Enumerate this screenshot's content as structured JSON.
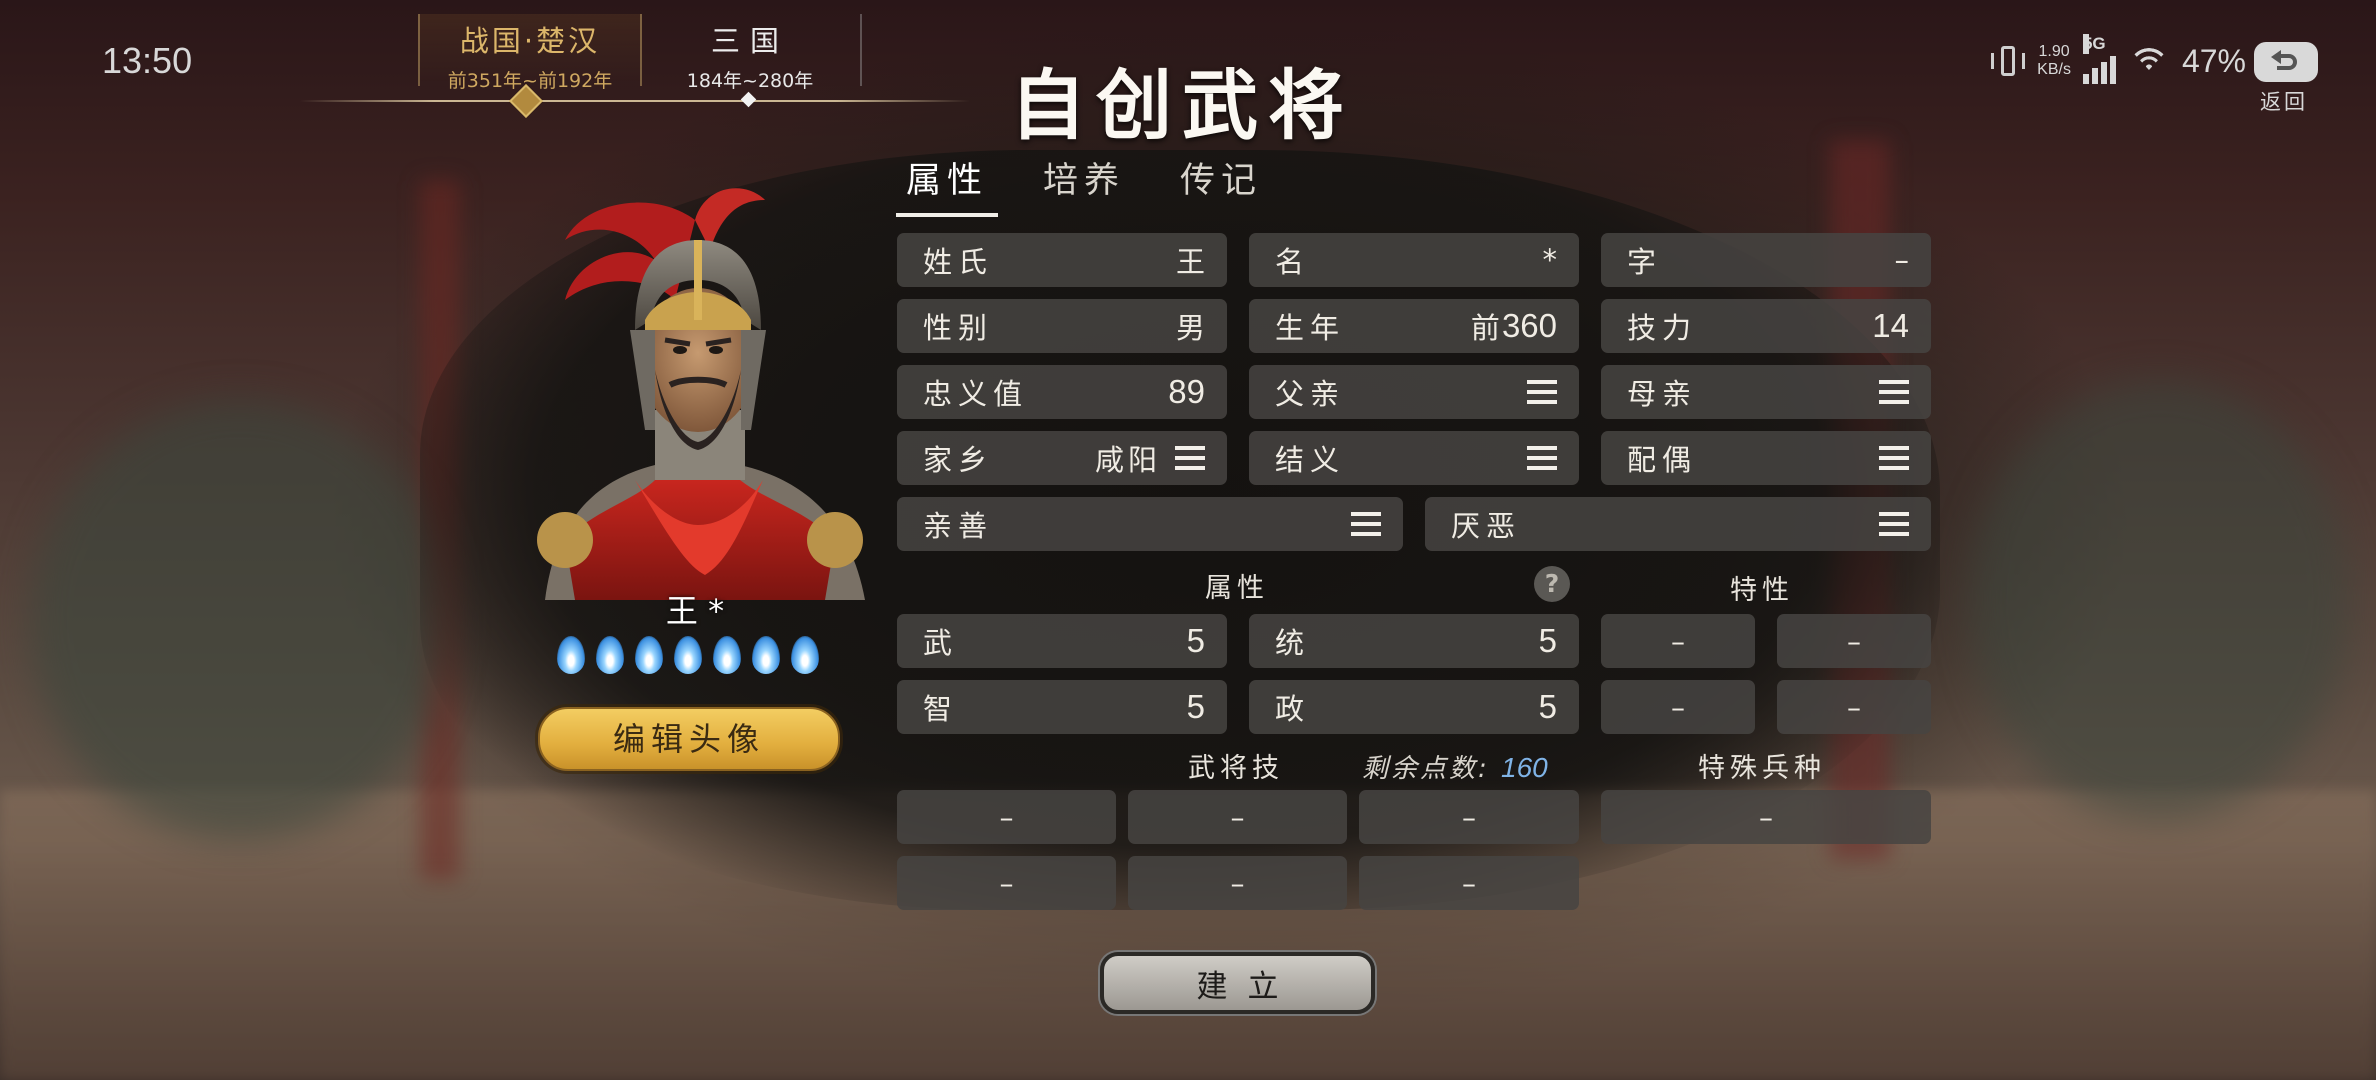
{
  "status_bar": {
    "time": "13:50",
    "net_speed_value": "1.90",
    "net_speed_unit": "KB/s",
    "signal_label": "5G",
    "battery": "47%",
    "back_label": "返回"
  },
  "era_timeline": {
    "eras": [
      {
        "name": "战国·楚汉",
        "years": "前351年~前192年",
        "selected": true
      },
      {
        "name": "三国",
        "years": "184年~280年",
        "selected": false
      }
    ]
  },
  "title": "自创武将",
  "tabs": [
    {
      "label": "属性",
      "active": true
    },
    {
      "label": "培养",
      "active": false
    },
    {
      "label": "传记",
      "active": false
    }
  ],
  "character": {
    "name": "王 *",
    "flame_count": 7,
    "edit_portrait_label": "编辑头像"
  },
  "info": {
    "surname": {
      "label": "姓氏",
      "value": "王"
    },
    "given_name": {
      "label": "名",
      "value": "*"
    },
    "courtesy_name": {
      "label": "字",
      "value": "–"
    },
    "gender": {
      "label": "性别",
      "value": "男"
    },
    "birth_year": {
      "label": "生年",
      "prefix": "前",
      "value": "360"
    },
    "skill_power": {
      "label": "技力",
      "value": "14"
    },
    "loyalty": {
      "label": "忠义值",
      "value": "89"
    },
    "father": {
      "label": "父亲"
    },
    "mother": {
      "label": "母亲"
    },
    "hometown": {
      "label": "家乡",
      "value": "咸阳"
    },
    "sworn": {
      "label": "结义"
    },
    "spouse": {
      "label": "配偶"
    },
    "likes": {
      "label": "亲善"
    },
    "dislikes": {
      "label": "厌恶"
    }
  },
  "attributes": {
    "header": "属性",
    "war": {
      "label": "武",
      "value": "5"
    },
    "command": {
      "label": "统",
      "value": "5"
    },
    "intellect": {
      "label": "智",
      "value": "5"
    },
    "politics": {
      "label": "政",
      "value": "5"
    }
  },
  "traits": {
    "header": "特性",
    "slots": [
      "–",
      "–",
      "–",
      "–"
    ]
  },
  "skills": {
    "header": "武将技",
    "points_label": "剩余点数:",
    "points_value": "160",
    "slots": [
      "–",
      "–",
      "–",
      "–",
      "–",
      "–"
    ]
  },
  "special_troop": {
    "header": "特殊兵种",
    "slot": "–"
  },
  "create_label": "建立"
}
